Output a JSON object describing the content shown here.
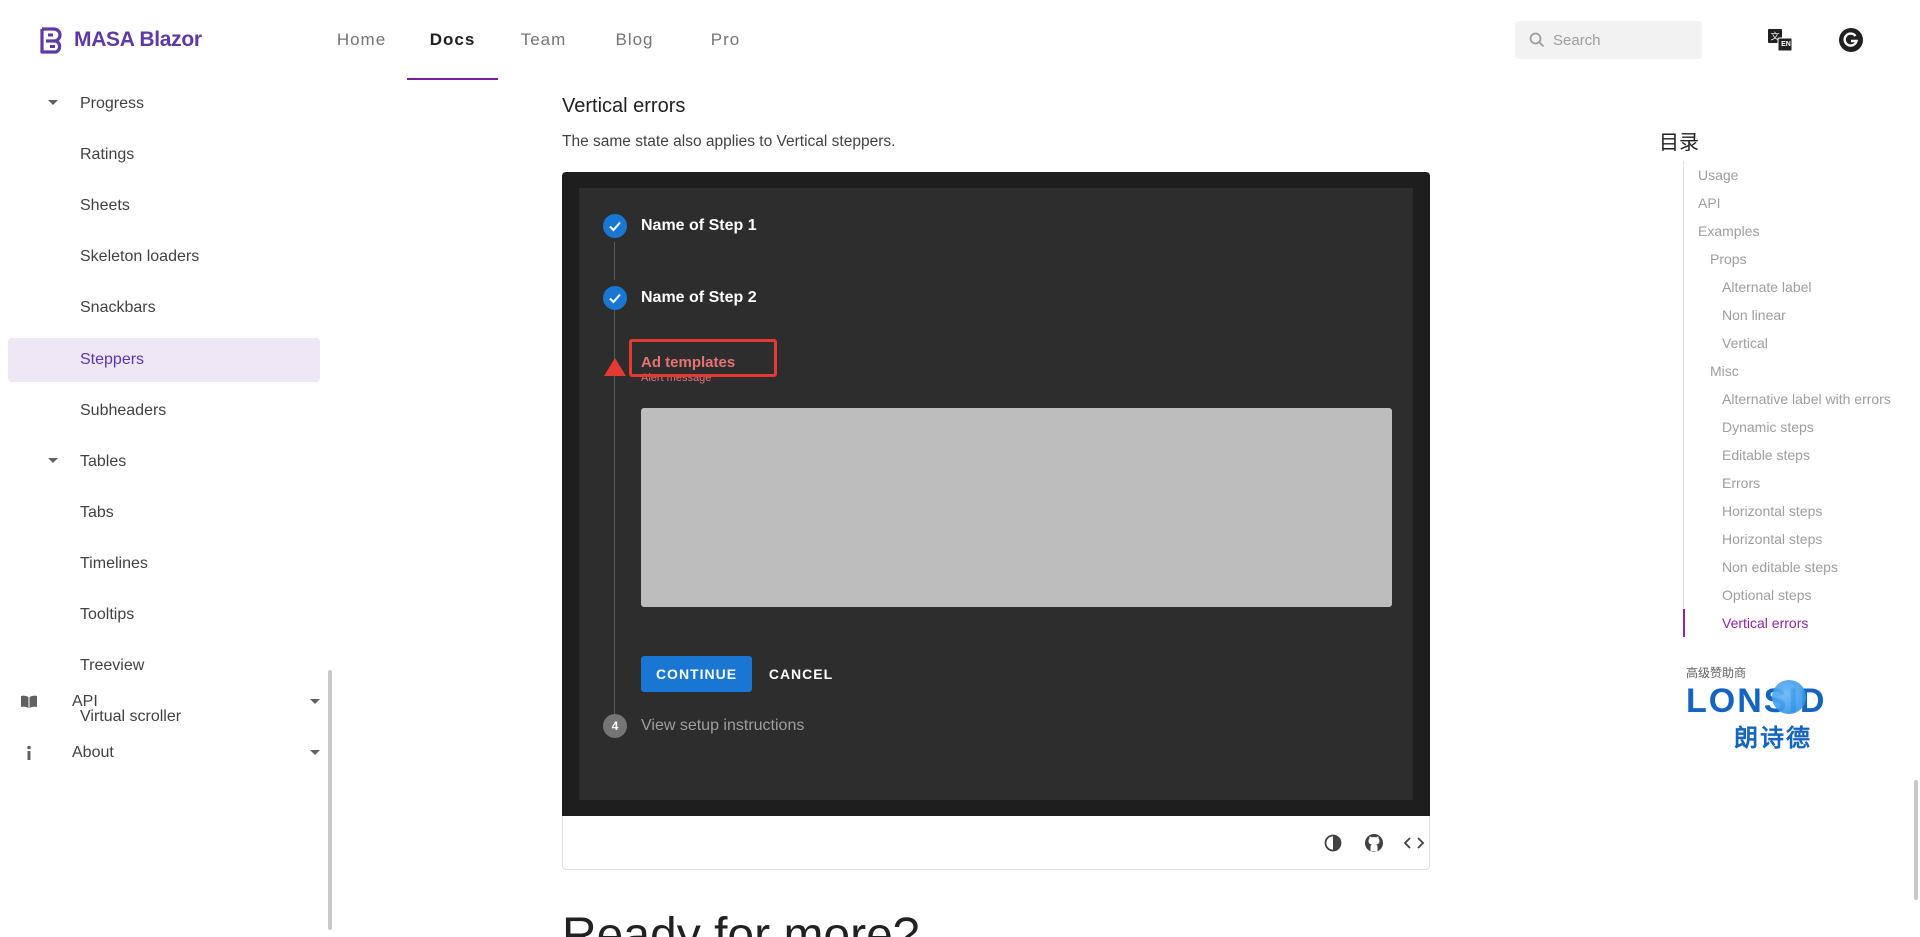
{
  "header": {
    "logo_text": "MASA Blazor",
    "nav": [
      "Home",
      "Docs",
      "Team",
      "Blog",
      "Pro"
    ],
    "active_nav": "Docs",
    "search_placeholder": "Search",
    "lang_badge": "EN"
  },
  "sidebar": {
    "items": [
      {
        "label": "Progress",
        "type": "expand"
      },
      {
        "label": "Ratings",
        "type": "item"
      },
      {
        "label": "Sheets",
        "type": "item"
      },
      {
        "label": "Skeleton loaders",
        "type": "item"
      },
      {
        "label": "Snackbars",
        "type": "item"
      },
      {
        "label": "Steppers",
        "type": "item",
        "active": true
      },
      {
        "label": "Subheaders",
        "type": "item"
      },
      {
        "label": "Tables",
        "type": "expand"
      },
      {
        "label": "Tabs",
        "type": "item"
      },
      {
        "label": "Timelines",
        "type": "item"
      },
      {
        "label": "Tooltips",
        "type": "item"
      },
      {
        "label": "Treeview",
        "type": "item"
      },
      {
        "label": "Virtual scroller",
        "type": "item"
      }
    ],
    "groups": [
      {
        "label": "API",
        "icon": "book-icon"
      },
      {
        "label": "About",
        "icon": "info-icon"
      }
    ]
  },
  "main": {
    "section_title": "Vertical errors",
    "section_desc": "The same state also applies to Vertical steppers.",
    "steps": [
      {
        "label": "Name of Step 1",
        "state": "complete"
      },
      {
        "label": "Name of Step 2",
        "state": "complete"
      },
      {
        "label": "Ad templates",
        "sublabel": "Alert message",
        "state": "error"
      },
      {
        "label": "View setup instructions",
        "number": "4",
        "state": "pending"
      }
    ],
    "continue_label": "CONTINUE",
    "cancel_label": "CANCEL",
    "ready_heading": "Ready for more?"
  },
  "toc": {
    "title": "目录",
    "items": [
      {
        "label": "Usage",
        "level": 0
      },
      {
        "label": "API",
        "level": 0
      },
      {
        "label": "Examples",
        "level": 0
      },
      {
        "label": "Props",
        "level": 1
      },
      {
        "label": "Alternate label",
        "level": 2
      },
      {
        "label": "Non linear",
        "level": 2
      },
      {
        "label": "Vertical",
        "level": 2
      },
      {
        "label": "Misc",
        "level": 1
      },
      {
        "label": "Alternative label with errors",
        "level": 2
      },
      {
        "label": "Dynamic steps",
        "level": 2
      },
      {
        "label": "Editable steps",
        "level": 2
      },
      {
        "label": "Errors",
        "level": 2
      },
      {
        "label": "Horizontal steps",
        "level": 2
      },
      {
        "label": "Horizontal steps",
        "level": 2
      },
      {
        "label": "Non editable steps",
        "level": 2
      },
      {
        "label": "Optional steps",
        "level": 2
      },
      {
        "label": "Vertical errors",
        "level": 2,
        "active": true
      }
    ]
  },
  "sponsor": {
    "label": "高级赞助商",
    "name": "LONSID",
    "name_cn": "朗诗德"
  },
  "colors": {
    "brand": "#5d3aa8",
    "accent": "#8e24aa",
    "primary": "#1976d2",
    "error": "#e53935"
  }
}
